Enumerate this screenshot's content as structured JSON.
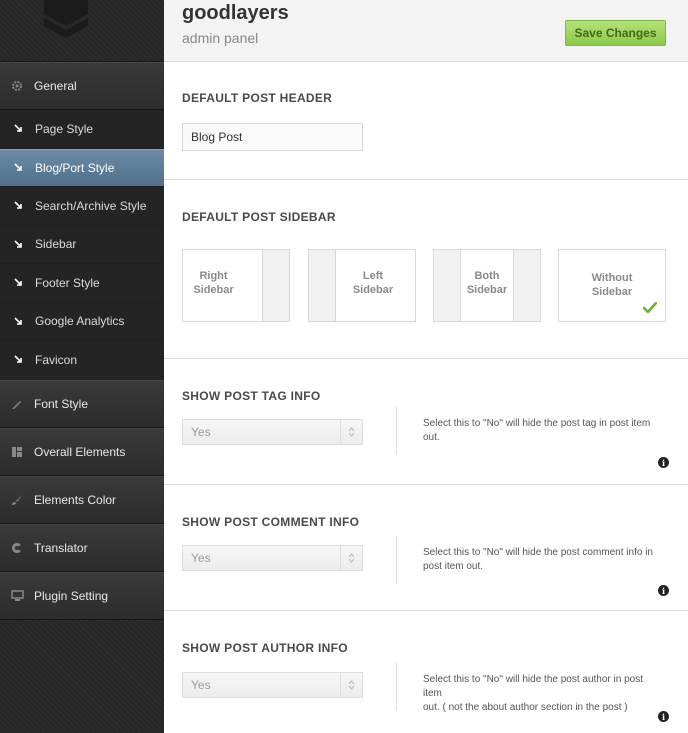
{
  "header": {
    "brand_title": "goodlayers",
    "brand_subtitle": "admin panel",
    "save_label": "Save Changes"
  },
  "sidebar": {
    "items": [
      {
        "label": "General",
        "icon": "gear-icon",
        "type": "main"
      },
      {
        "label": "Page Style",
        "icon": "arrow-icon",
        "type": "sub"
      },
      {
        "label": "Blog/Port Style",
        "icon": "arrow-icon",
        "type": "sub",
        "active": true
      },
      {
        "label": "Search/Archive Style",
        "icon": "arrow-icon",
        "type": "sub"
      },
      {
        "label": "Sidebar",
        "icon": "arrow-icon",
        "type": "sub"
      },
      {
        "label": "Footer Style",
        "icon": "arrow-icon",
        "type": "sub"
      },
      {
        "label": "Google Analytics",
        "icon": "arrow-icon",
        "type": "sub"
      },
      {
        "label": "Favicon",
        "icon": "arrow-icon",
        "type": "sub"
      },
      {
        "label": "Font Style",
        "icon": "pencil-icon",
        "type": "main"
      },
      {
        "label": "Overall Elements",
        "icon": "layout-icon",
        "type": "main"
      },
      {
        "label": "Elements Color",
        "icon": "brush-icon",
        "type": "main"
      },
      {
        "label": "Translator",
        "icon": "translate-icon",
        "type": "main"
      },
      {
        "label": "Plugin Setting",
        "icon": "monitor-icon",
        "type": "main"
      }
    ]
  },
  "main": {
    "post_header": {
      "title": "DEFAULT POST HEADER",
      "value": "Blog Post"
    },
    "post_sidebar": {
      "title": "DEFAULT POST SIDEBAR",
      "options": [
        {
          "line1": "Right",
          "line2": "Sidebar"
        },
        {
          "line1": "Left",
          "line2": "Sidebar"
        },
        {
          "line1": "Both",
          "line2": "Sidebar"
        },
        {
          "line1": "Without",
          "line2": "Sidebar"
        }
      ],
      "selected": "Without Sidebar"
    },
    "tag_info": {
      "title": "SHOW POST TAG INFO",
      "value": "Yes",
      "desc_line1": "Select this to \"No\" will hide the post tag in post item",
      "desc_line2": "out."
    },
    "comment_info": {
      "title": "SHOW POST COMMENT INFO",
      "value": "Yes",
      "desc_line1": "Select this to \"No\" will hide the post comment info in",
      "desc_line2": "post item out."
    },
    "author_info": {
      "title": "SHOW POST AUTHOR INFO",
      "value": "Yes",
      "desc_line1": "Select this to \"No\" will hide the post author in post item",
      "desc_line2": "out. ( not the about author section in the post )"
    }
  }
}
